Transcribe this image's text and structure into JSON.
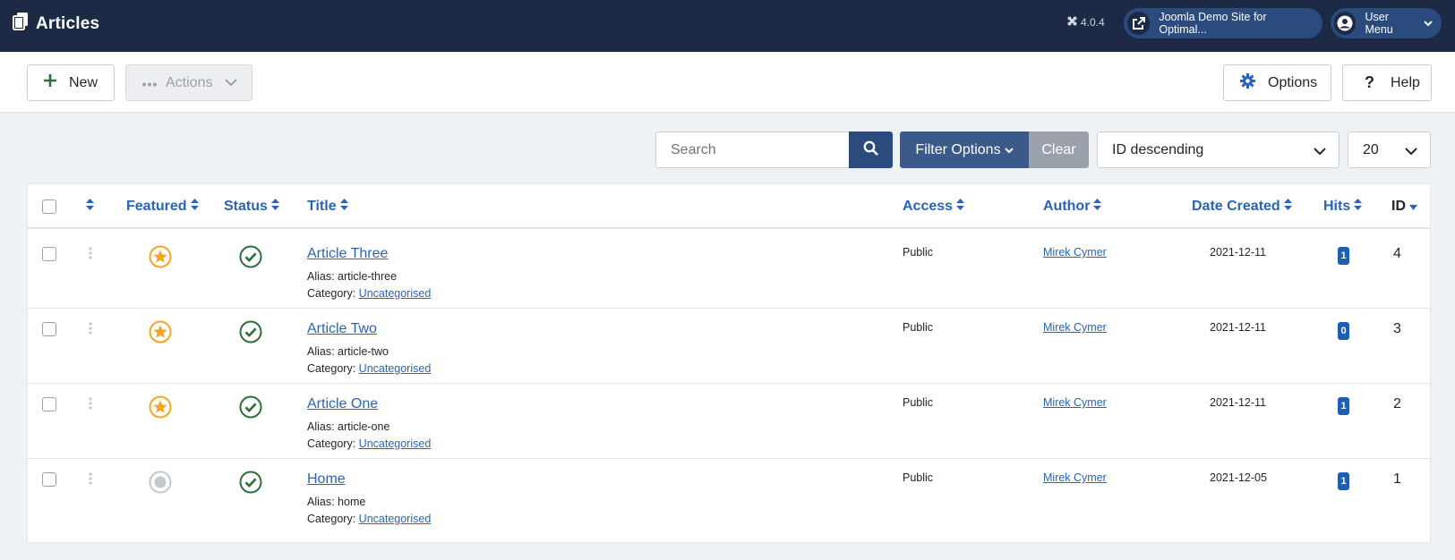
{
  "header": {
    "title": "Articles",
    "version": "4.0.4",
    "site_link": "Joomla Demo Site for Optimal...",
    "user_menu": "User Menu"
  },
  "toolbar": {
    "new_label": "New",
    "actions_label": "Actions",
    "options_label": "Options",
    "help_label": "Help"
  },
  "filters": {
    "search_placeholder": "Search",
    "filter_options_label": "Filter Options",
    "clear_label": "Clear",
    "ordering_value": "ID descending",
    "limit_value": "20"
  },
  "table": {
    "columns": {
      "featured": "Featured",
      "status": "Status",
      "title": "Title",
      "access": "Access",
      "author": "Author",
      "date_created": "Date Created",
      "hits": "Hits",
      "id": "ID"
    },
    "alias_prefix": "Alias: ",
    "category_prefix": "Category: ",
    "rows": [
      {
        "title": "Article Three",
        "alias": "article-three",
        "category": "Uncategorised",
        "featured": true,
        "access": "Public",
        "author": "Mirek Cymer",
        "date": "2021-12-11",
        "hits": "1",
        "id": "4"
      },
      {
        "title": "Article Two",
        "alias": "article-two",
        "category": "Uncategorised",
        "featured": true,
        "access": "Public",
        "author": "Mirek Cymer",
        "date": "2021-12-11",
        "hits": "0",
        "id": "3"
      },
      {
        "title": "Article One",
        "alias": "article-one",
        "category": "Uncategorised",
        "featured": true,
        "access": "Public",
        "author": "Mirek Cymer",
        "date": "2021-12-11",
        "hits": "1",
        "id": "2"
      },
      {
        "title": "Home",
        "alias": "home",
        "category": "Uncategorised",
        "featured": false,
        "access": "Public",
        "author": "Mirek Cymer",
        "date": "2021-12-05",
        "hits": "1",
        "id": "1"
      }
    ]
  },
  "colors": {
    "header_bg": "#1c2a45",
    "accent": "#2a64b7",
    "featured_star": "#f5a623",
    "published_check": "#2f6f3e"
  },
  "icons": {
    "title": "copy-icon",
    "version": "joomla-icon",
    "site": "external-link-icon",
    "user": "user-circle-icon",
    "new": "plus-icon",
    "actions": "ellipsis-icon",
    "options": "gear-icon",
    "help": "question-icon",
    "search": "search-icon",
    "sort": "sort-icon",
    "drag": "drag-handle-icon",
    "featured": "star-icon",
    "unfeatured": "unfeatured-icon",
    "status": "published-check-icon"
  }
}
